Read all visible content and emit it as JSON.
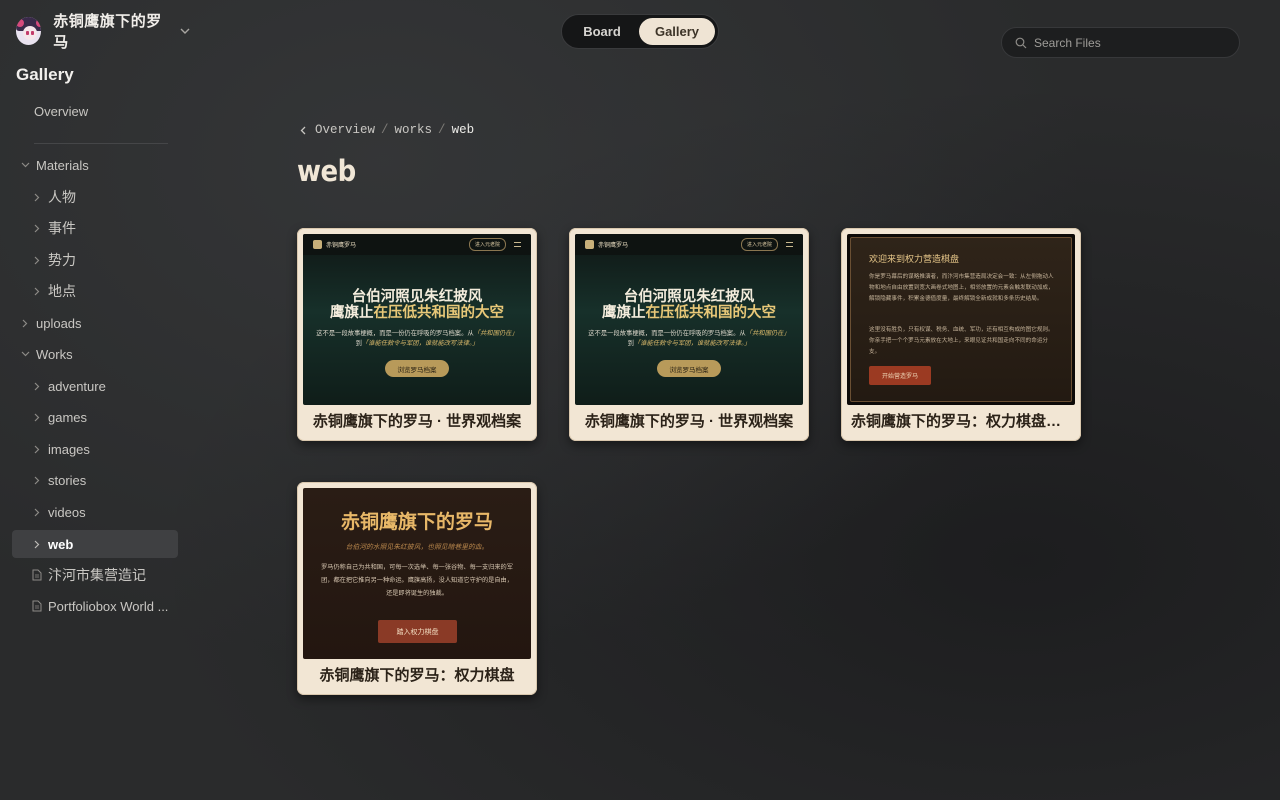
{
  "workspace": {
    "name": "赤铜鹰旗下的罗马"
  },
  "sidebar": {
    "heading": "Gallery",
    "overview": "Overview",
    "tree": [
      {
        "label": "Materials",
        "expanded": true,
        "level": 0
      },
      {
        "label": "人物",
        "level": 1
      },
      {
        "label": "事件",
        "level": 1
      },
      {
        "label": "势力",
        "level": 1
      },
      {
        "label": "地点",
        "level": 1
      },
      {
        "label": "uploads",
        "level": 0
      },
      {
        "label": "Works",
        "expanded": true,
        "level": 0
      },
      {
        "label": "adventure",
        "level": 1
      },
      {
        "label": "games",
        "level": 1
      },
      {
        "label": "images",
        "level": 1
      },
      {
        "label": "stories",
        "level": 1
      },
      {
        "label": "videos",
        "level": 1
      },
      {
        "label": "web",
        "level": 1,
        "active": true
      }
    ],
    "docs": [
      {
        "label": "汴河市集营造记"
      },
      {
        "label": "Portfoliobox World ..."
      }
    ]
  },
  "toggle": {
    "board": "Board",
    "gallery": "Gallery",
    "selected": "Gallery"
  },
  "search": {
    "placeholder": "Search Files",
    "value": ""
  },
  "breadcrumb": {
    "items": [
      "Overview",
      "works",
      "web"
    ]
  },
  "page": {
    "title": "web"
  },
  "cards": [
    {
      "title": "赤铜鹰旗下的罗马 · 世界观档案",
      "thumb": {
        "brand": "赤铜鹰罗马",
        "nav_button": "进入元老院",
        "line1": "台伯河照见朱红披风",
        "line2_pre": "鹰旗止",
        "line2_hl": "在压低共和国的大空",
        "sub_a": "这不是一段故事梗概，而是一份仍在呼吸的罗马档案。从",
        "sub_b": "「共和国仍在」",
        "sub_c": "到",
        "sub_d": "「谁能任敕令与军团，谁就能改写法律。」",
        "cta": "浏览罗马档案"
      }
    },
    {
      "title": "赤铜鹰旗下的罗马 · 世界观档案",
      "thumb": {
        "brand": "赤铜鹰罗马",
        "nav_button": "进入元老院",
        "line1": "台伯河照见朱红披风",
        "line2_pre": "鹰旗止",
        "line2_hl": "在压低共和国的大空",
        "sub_a": "这不是一段故事梗概，而是一份仍在呼吸的罗马档案。从",
        "sub_b": "「共和国仍在」",
        "sub_c": "到",
        "sub_d": "「谁能任敕令与军团，谁就能改写法律。」",
        "cta": "浏览罗马档案"
      }
    },
    {
      "title": "赤铜鹰旗下的罗马：权力棋盘营...",
      "thumb": {
        "heading": "欢迎来到权力营造棋盘",
        "p1": "你是罗马幕后的谋略推演者，而汴河市集营造局决定会一致：从左侧拖动人物和地点自由放置到宽大画卷式地图上，相邻放置的元素会触发联动加成，解锁隐藏事件，积累金德值度量，最终解锁全新成就和多条历史结局。",
        "p2": "这里没有胜负，只有权谋、税务、血统、军功，还有相互构成的图它规则。你亲手把一个个罗马元素放在大地上，来眼见证共和国走向不同的命运分支。",
        "button": "开始营造罗马"
      }
    },
    {
      "title": "赤铜鹰旗下的罗马：权力棋盘",
      "thumb": {
        "title": "赤铜鹰旗下的罗马",
        "subtitle": "台伯河的水照见朱红披风，也照见暗巷里的血。",
        "body": "罗马仍称自己为共和国，可每一次选举、每一张谷物、每一支归来的军团，都在把它推向另一种命运。鹰旗高扬，没人知道它守护的是自由，还是即将诞生的独裁。",
        "button": "踏入权力棋盘"
      }
    }
  ]
}
